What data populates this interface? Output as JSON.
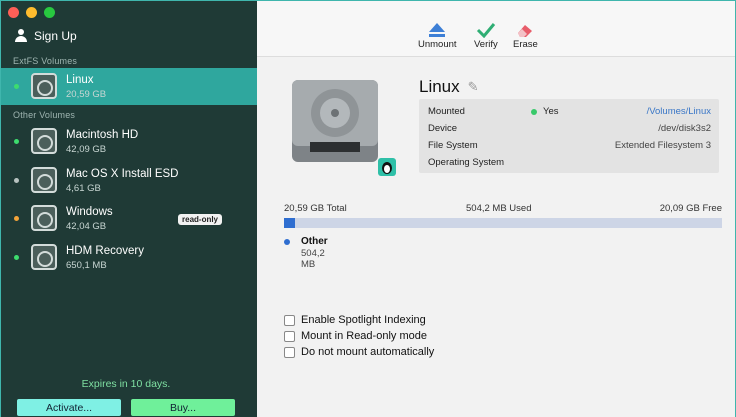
{
  "sidebar": {
    "sign_up": "Sign Up",
    "section_extfs": "ExtFS Volumes",
    "section_other": "Other Volumes",
    "volumes": [
      {
        "name": "Linux",
        "size": "20,59 GB",
        "status_color": "#3ddc6e"
      },
      {
        "name": "Macintosh HD",
        "size": "42,09 GB",
        "status_color": "#3ddc6e"
      },
      {
        "name": "Mac OS X Install ESD",
        "size": "4,61 GB",
        "status_color": "#b7c2c0"
      },
      {
        "name": "Windows",
        "size": "42,04 GB",
        "status_color": "#f3a43a",
        "badge": "read-only"
      },
      {
        "name": "HDM Recovery",
        "size": "650,1 MB",
        "status_color": "#3ddc6e"
      }
    ],
    "expires": "Expires in 10 days.",
    "activate": "Activate...",
    "buy": "Buy..."
  },
  "toolbar": {
    "unmount": "Unmount",
    "verify": "Verify",
    "erase": "Erase"
  },
  "detail": {
    "title": "Linux",
    "rows": [
      {
        "label": "Mounted",
        "status": "Yes",
        "value": "/Volumes/Linux"
      },
      {
        "label": "Device",
        "value": "/dev/disk3s2"
      },
      {
        "label": "File System",
        "value": "Extended Filesystem 3"
      },
      {
        "label": "Operating System",
        "value": ""
      }
    ],
    "total": "20,59 GB Total",
    "used": "504,2 MB Used",
    "free": "20,09 GB Free",
    "used_fraction": 0.024,
    "legend_name": "Other",
    "legend_size": "504,2 MB"
  },
  "options": [
    {
      "label": "Enable Spotlight Indexing",
      "checked": false
    },
    {
      "label": "Mount in Read-only mode",
      "checked": false
    },
    {
      "label": "Do not mount automatically",
      "checked": false
    }
  ],
  "colors": {
    "accent": "#2fa79e",
    "sidebar": "#1f3a36",
    "bar_fill": "#2f6ed0"
  }
}
